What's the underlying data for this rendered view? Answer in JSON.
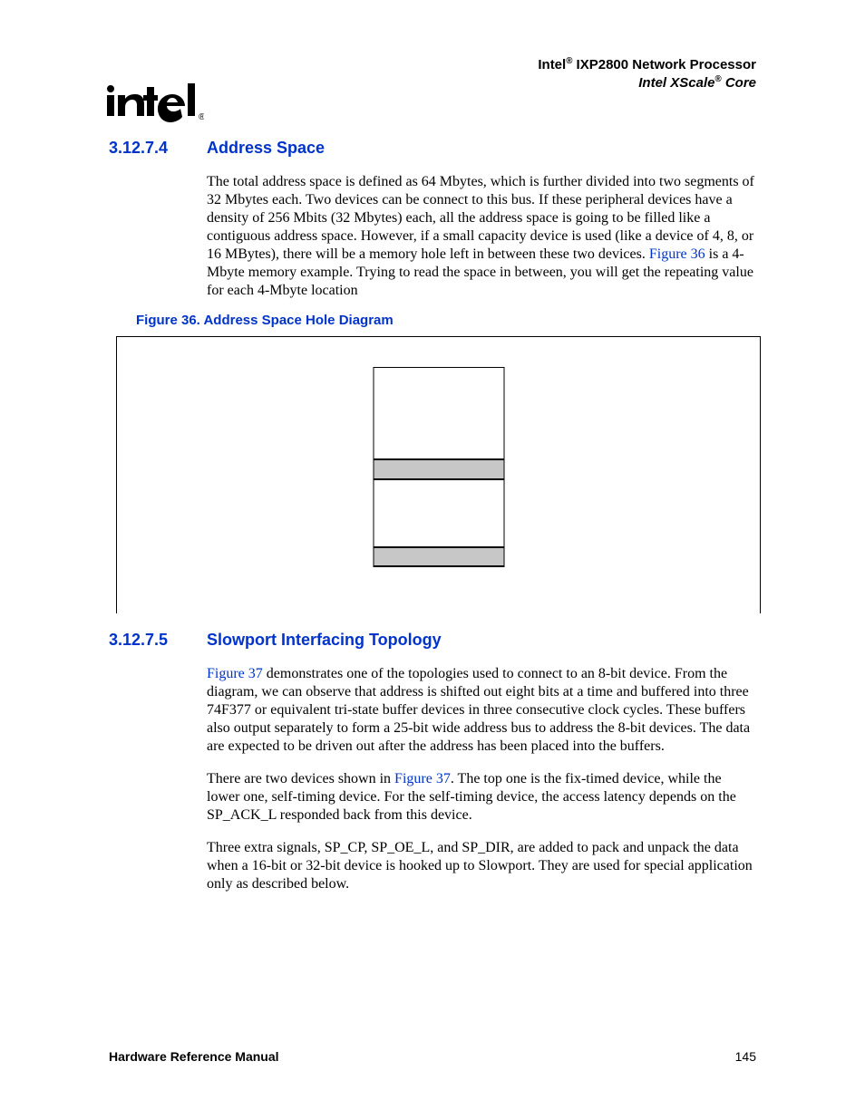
{
  "header": {
    "line1_prefix": "Intel",
    "line1_rest": " IXP2800 Network Processor",
    "line2_prefix": "Intel XScale",
    "line2_rest": " Core"
  },
  "logo": {
    "name": "intel-logo"
  },
  "section1": {
    "num": "3.12.7.4",
    "title": "Address Space",
    "para1_a": "The total address space is defined as 64 Mbytes, which is further divided into two segments of 32 Mbytes each. Two devices can be connect to this bus. If these peripheral devices have a density of 256 Mbits (32 Mbytes) each, all the address space is going to be filled like a contiguous address space. However, if a small capacity device is used (like a device of 4, 8, or 16 MBytes), there will be a memory hole left in between these two devices. ",
    "para1_ref": "Figure 36",
    "para1_b": " is a 4-Mbyte memory example. Trying to read the space in between, you will get the repeating value for each 4-Mbyte location"
  },
  "figure": {
    "caption": "Figure 36. Address Space Hole Diagram"
  },
  "section2": {
    "num": "3.12.7.5",
    "title": "Slowport Interfacing Topology",
    "para1_ref": "Figure 37",
    "para1_rest": " demonstrates one of the topologies used to connect to an 8-bit device. From the diagram, we can observe that address is shifted out eight bits at a time and buffered into three 74F377 or equivalent tri-state buffer devices in three consecutive clock cycles. These buffers also output separately to form a 25-bit wide address bus to address the 8-bit devices. The data are expected to be driven out after the address has been placed into the buffers.",
    "para2_a": "There are two devices shown in ",
    "para2_ref": "Figure 37",
    "para2_b": ". The top one is the fix-timed device, while the lower one, self-timing device. For the self-timing device, the access latency depends on the SP_ACK_L responded back from this device.",
    "para3": "Three extra signals, SP_CP, SP_OE_L, and SP_DIR, are added to pack and unpack the data when a 16-bit or 32-bit device is hooked up to Slowport. They are used for special application only as described below."
  },
  "footer": {
    "left": "Hardware Reference Manual",
    "right": "145"
  }
}
